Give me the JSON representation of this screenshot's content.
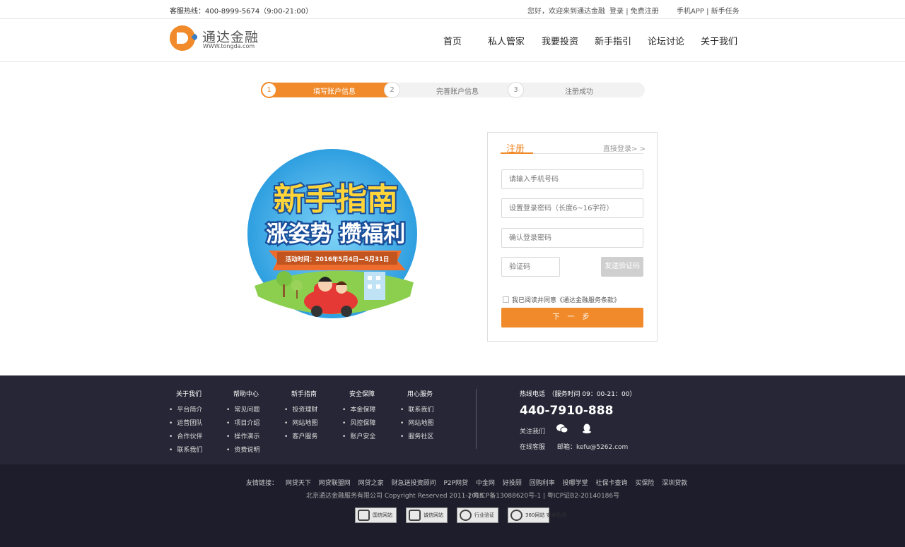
{
  "topbar": {
    "hotline": "客服热线：400-8999-5674（9:00-21:00）",
    "welcome": "您好，欢迎来到通达金融",
    "login": "登录",
    "sep1": "|",
    "register": "免费注册",
    "app": "手机APP",
    "sep2": "|",
    "tasks": "新手任务"
  },
  "logo": {
    "name": "通达金融",
    "url": "WWW.tongda.com"
  },
  "nav": [
    "首页",
    "私人管家",
    "我要投资",
    "新手指引",
    "论坛讨论",
    "关于我们"
  ],
  "steps": [
    {
      "num": "1",
      "label": "填写账户信息"
    },
    {
      "num": "2",
      "label": "完善账户信息"
    },
    {
      "num": "3",
      "label": "注册成功"
    }
  ],
  "promo": {
    "title": "新手指南",
    "subtitle": "涨姿势 攒福利",
    "period": "活动时间：2016年5月4日—5月31日"
  },
  "register": {
    "tab": "注册",
    "login_link": "直接登录> >",
    "phone_placeholder": "请输入手机号码",
    "password_placeholder": "设置登录密码（长度6~16字符）",
    "confirm_placeholder": "确认登录密码",
    "code_placeholder": "验证码",
    "sms_button": "发送验证码",
    "agree_text": "我已阅读并同意《通达金融服务条款》",
    "next_button": "下 一 步"
  },
  "footer": {
    "columns": [
      {
        "title": "关于我们",
        "items": [
          "平台简介",
          "运营团队",
          "合作伙伴",
          "联系我们"
        ]
      },
      {
        "title": "帮助中心",
        "items": [
          "常见问题",
          "项目介绍",
          "操作演示",
          "资费说明"
        ]
      },
      {
        "title": "新手指南",
        "items": [
          "投资理财",
          "网站地图",
          "客户服务"
        ]
      },
      {
        "title": "安全保障",
        "items": [
          "本金保障",
          "风控保障",
          "账户安全"
        ]
      },
      {
        "title": "用心服务",
        "items": [
          "联系我们",
          "网站地图",
          "服务社区"
        ]
      }
    ],
    "hotline_title": "热线电话　（服务时间 09：00-21：00）",
    "hotline_number": "440-7910-888",
    "follow_label": "关注我们",
    "online_label": "在线客服",
    "email": "邮箱：kefu@5262.com",
    "friend_links_label": "友情链接：",
    "friend_links": [
      "网贷天下",
      "网贷联盟网",
      "网贷之家",
      "财急送投资顾问",
      "P2P网贷",
      "中金网",
      "好投顾",
      "回购利率",
      "投哪学堂",
      "社保卡查询",
      "买保险",
      "深圳贷款"
    ],
    "copyright": "北京通达金融服务有限公司 Copyright Reserved 2011-2015",
    "icp": "| 粤ICP备13088620号-1 | 粤ICP证B2-20140186号",
    "badges": [
      "国信网站",
      "诚信网站",
      "行业验证",
      "360网站 安全检测"
    ]
  }
}
